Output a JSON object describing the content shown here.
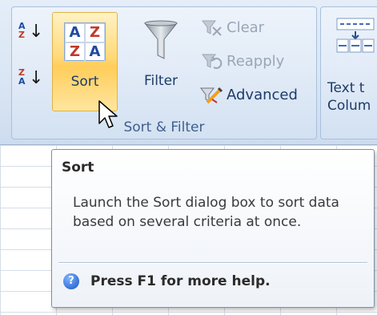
{
  "ribbon": {
    "group_label": "Sort & Filter",
    "sort_button": {
      "label": "Sort",
      "icon_letters": [
        "A",
        "Z",
        "Z",
        "A"
      ]
    },
    "small_sort_az": {
      "top": "A",
      "bottom": "Z"
    },
    "small_sort_za": {
      "top": "Z",
      "bottom": "A"
    },
    "filter_button": {
      "label": "Filter"
    },
    "clear": {
      "label": "Clear"
    },
    "reapply": {
      "label": "Reapply"
    },
    "advanced": {
      "label": "Advanced"
    },
    "text_to_columns": {
      "line1": "Text t",
      "line2": "Colum"
    }
  },
  "tooltip": {
    "title": "Sort",
    "body": "Launch the Sort dialog box to sort data based on several criteria at once.",
    "help_text": "Press F1 for more help.",
    "help_icon": "?"
  },
  "colors": {
    "sort_highlight": "#ffd97a",
    "label_blue": "#1d3b6a",
    "disabled_gray": "#9aa6b6"
  }
}
